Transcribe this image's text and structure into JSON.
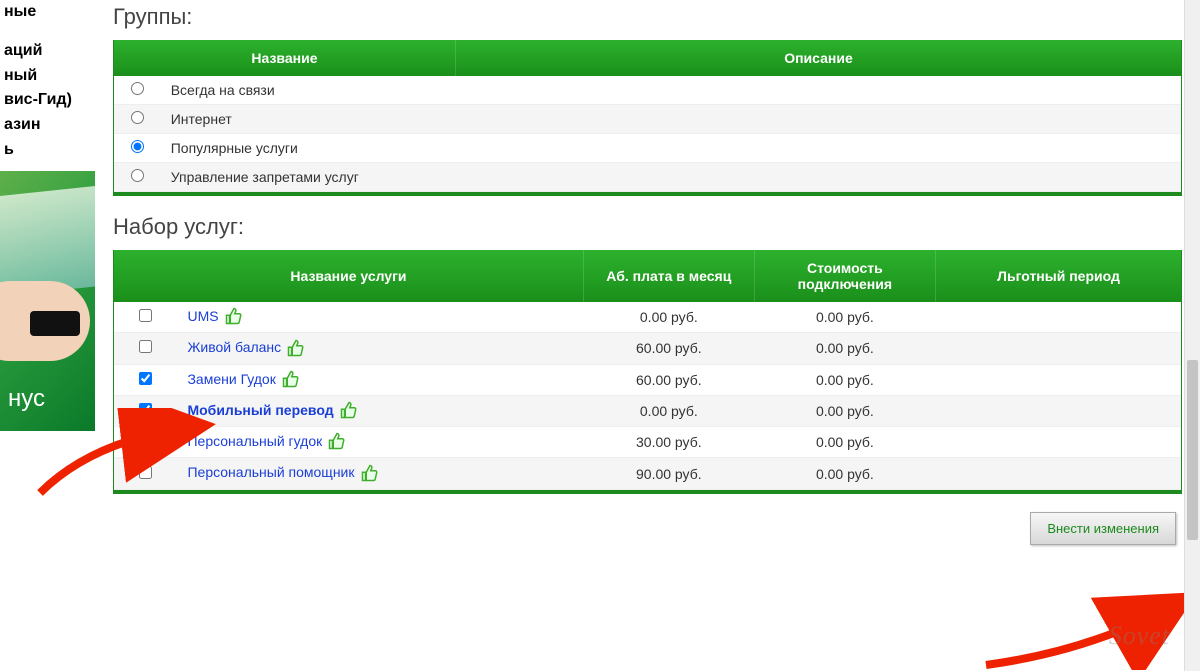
{
  "sidebar": {
    "items": [
      {
        "label": "ные"
      },
      {
        "label": "аций"
      },
      {
        "label": "ный"
      },
      {
        "label": "вис-Гид)"
      },
      {
        "label": "азин"
      },
      {
        "label": "ь"
      }
    ],
    "banner_text": "нус"
  },
  "groups": {
    "title": "Группы:",
    "header_name": "Название",
    "header_desc": "Описание",
    "rows": [
      {
        "label": "Всегда на связи",
        "selected": false
      },
      {
        "label": "Интернет",
        "selected": false
      },
      {
        "label": "Популярные услуги",
        "selected": true
      },
      {
        "label": "Управление запретами услуг",
        "selected": false
      }
    ]
  },
  "services": {
    "title": "Набор услуг:",
    "header_name": "Название услуги",
    "header_fee": "Аб. плата в месяц",
    "header_cost": "Стоимость подключения",
    "header_grace": "Льготный период",
    "currency_suffix": " руб.",
    "rows": [
      {
        "label": "UMS",
        "checked": false,
        "bold": false,
        "fee": "0.00 руб.",
        "cost": "0.00 руб.",
        "grace": ""
      },
      {
        "label": "Живой баланс",
        "checked": false,
        "bold": false,
        "fee": "60.00 руб.",
        "cost": "0.00 руб.",
        "grace": ""
      },
      {
        "label": "Замени Гудок",
        "checked": true,
        "bold": false,
        "fee": "60.00 руб.",
        "cost": "0.00 руб.",
        "grace": ""
      },
      {
        "label": "Мобильный перевод",
        "checked": true,
        "bold": true,
        "fee": "0.00 руб.",
        "cost": "0.00 руб.",
        "grace": ""
      },
      {
        "label": "Персональный гудок",
        "checked": false,
        "bold": false,
        "fee": "30.00 руб.",
        "cost": "0.00 руб.",
        "grace": ""
      },
      {
        "label": "Персональный помощник",
        "checked": false,
        "bold": false,
        "fee": "90.00 руб.",
        "cost": "0.00 руб.",
        "grace": ""
      }
    ]
  },
  "submit_label": "Внести изменения",
  "watermark": "Sovet",
  "colors": {
    "accent": "#1d9a1d",
    "link": "#1a3fd6",
    "thumb": "#3fae2a"
  }
}
